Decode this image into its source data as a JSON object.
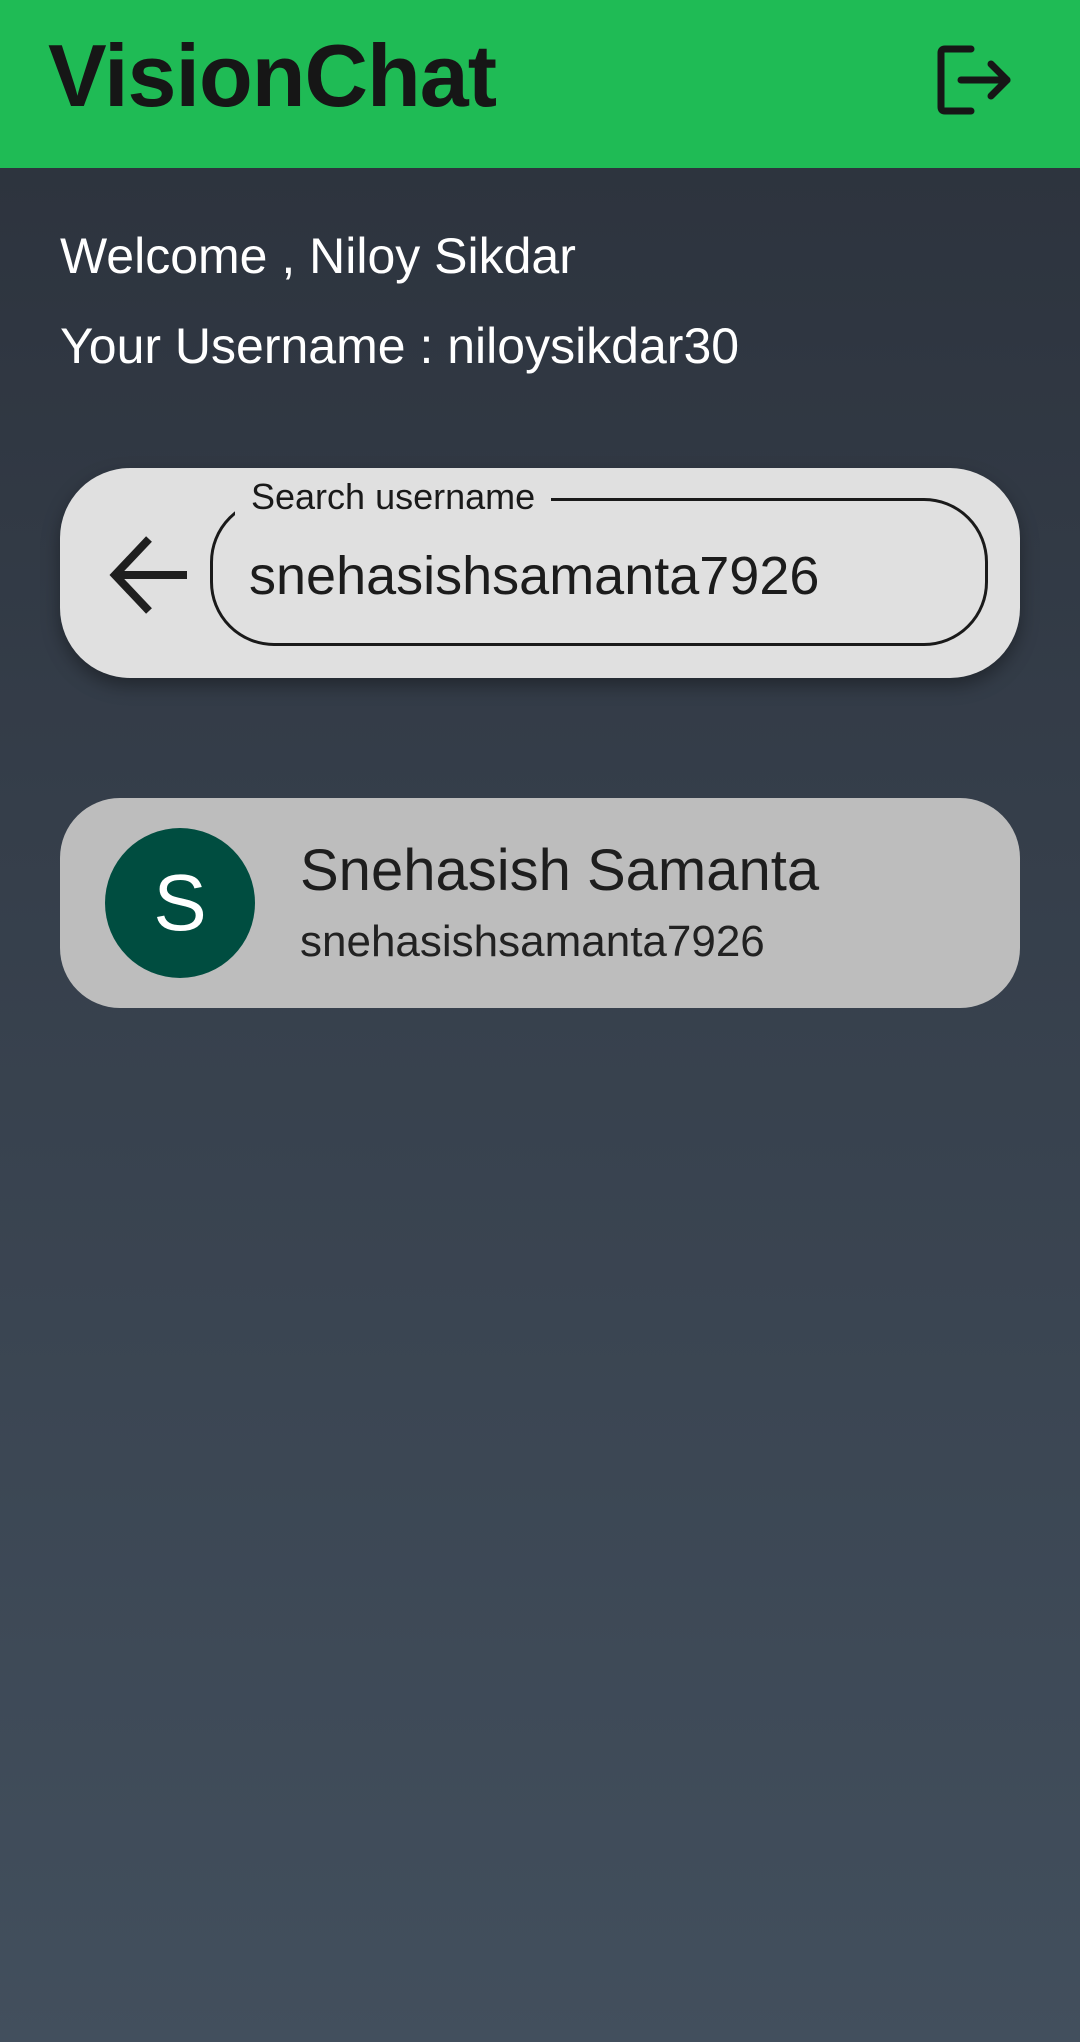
{
  "app_bar": {
    "title": "VisionChat",
    "logout_icon": "logout-icon"
  },
  "greeting": {
    "welcome_text": "Welcome , Niloy Sikdar",
    "username_text": "Your Username : niloysikdar30"
  },
  "search": {
    "back_icon": "arrow-back-icon",
    "label": "Search username",
    "value": "snehasishsamanta7926"
  },
  "results": [
    {
      "avatar_initial": "S",
      "name": "Snehasish Samanta",
      "username": "snehasishsamanta7926"
    }
  ],
  "colors": {
    "app_bar": "#1fbb55",
    "avatar": "#004d40",
    "search_card": "#e0e0e0",
    "result_card": "#bdbdbd"
  }
}
